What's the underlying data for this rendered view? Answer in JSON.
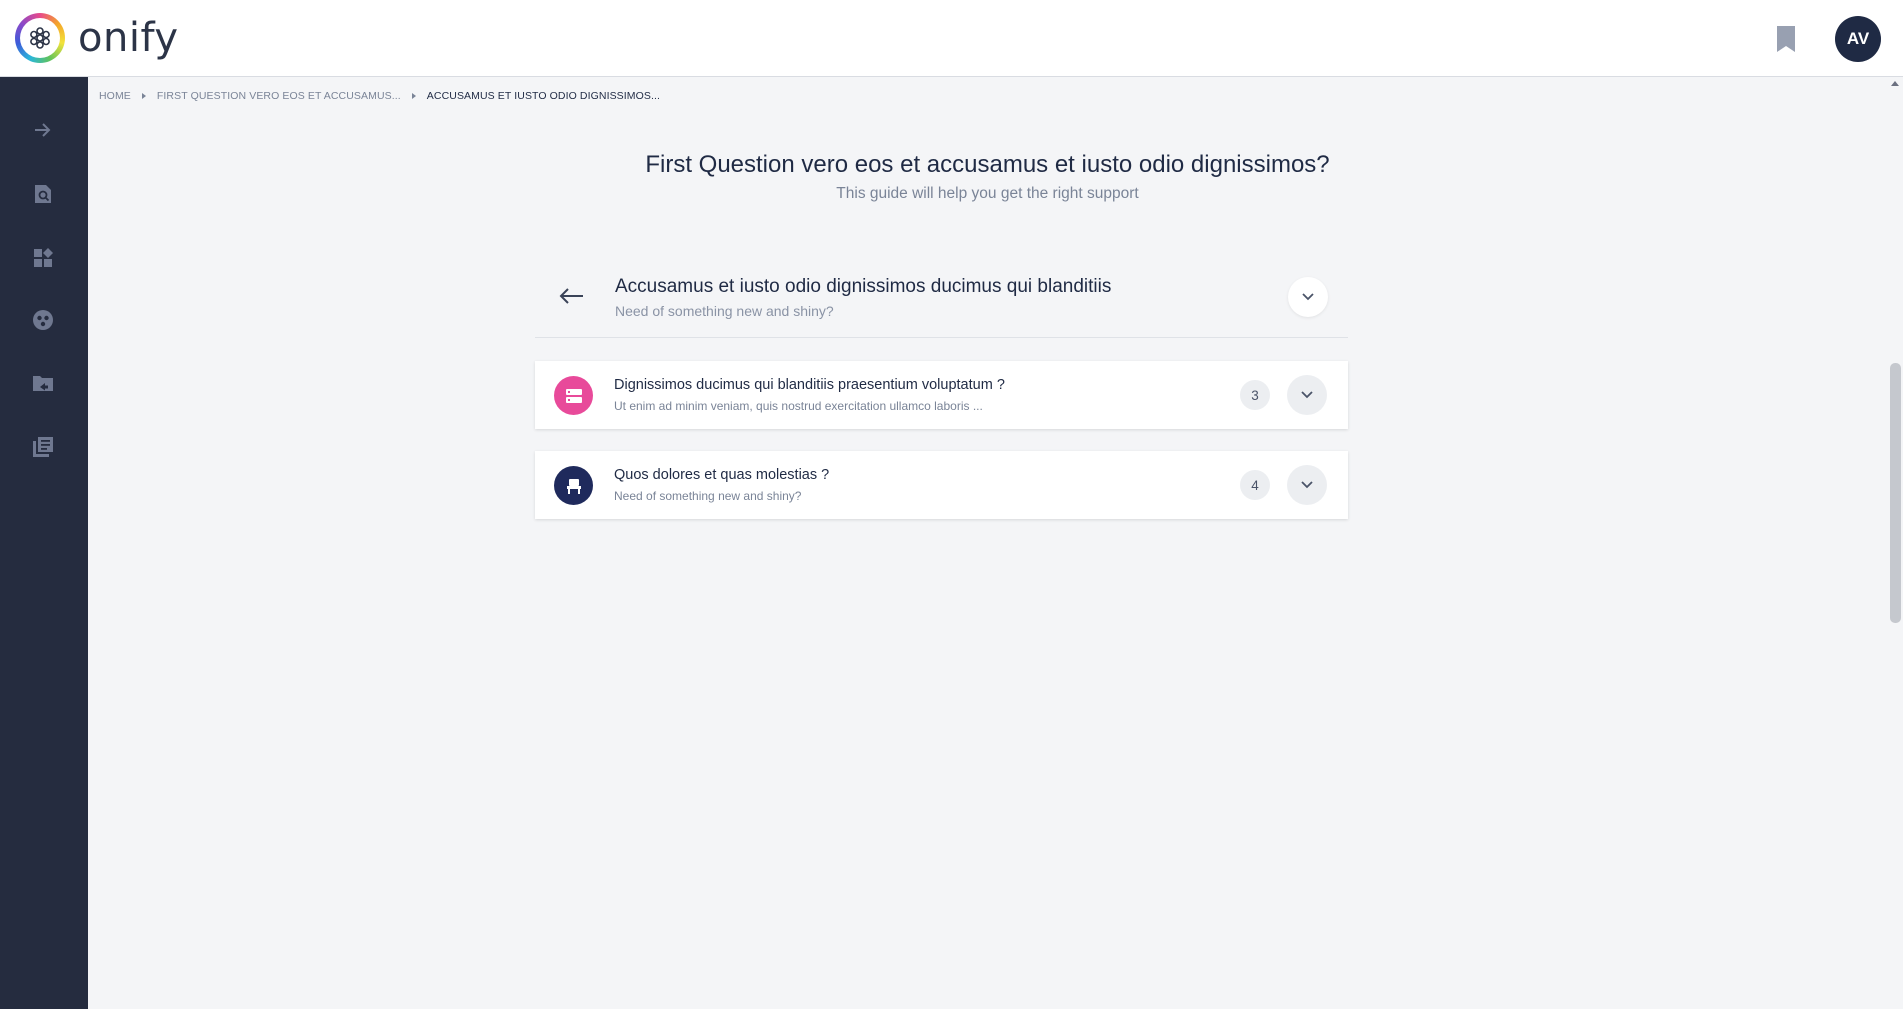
{
  "app": {
    "name": "onify",
    "user_initials": "AV"
  },
  "colors": {
    "sidebar_bg": "#252c3f",
    "card1_icon_bg": "#e84a9a",
    "card2_icon_bg": "#1f2a5c",
    "avatar_bg": "#1f2a44"
  },
  "sidebar": {
    "items": [
      {
        "icon": "arrow-right-icon"
      },
      {
        "icon": "search-document-icon"
      },
      {
        "icon": "widgets-icon"
      },
      {
        "icon": "group-icon"
      },
      {
        "icon": "folder-shared-icon"
      },
      {
        "icon": "library-icon"
      }
    ]
  },
  "breadcrumb": {
    "home": "HOME",
    "level1": "FIRST QUESTION VERO EOS ET ACCUSAMUS...",
    "current": "ACCUSAMUS ET IUSTO ODIO DIGNISSIMOS..."
  },
  "page": {
    "title": "First Question vero eos et accusamus et iusto odio dignissimos?",
    "subtitle": "This guide will help you get the right support"
  },
  "question": {
    "title": "Accusamus et iusto odio dignissimos ducimus qui blanditiis",
    "subtitle": "Need of something new and shiny?"
  },
  "cards": [
    {
      "title": "Dignissimos ducimus qui blanditiis praesentium voluptatum ?",
      "subtitle": "Ut enim ad minim veniam, quis nostrud exercitation ullamco laboris ...",
      "count": "3",
      "icon": "server-icon"
    },
    {
      "title": "Quos dolores et quas molestias ?",
      "subtitle": "Need of something new and shiny?",
      "count": "4",
      "icon": "chair-icon"
    }
  ]
}
